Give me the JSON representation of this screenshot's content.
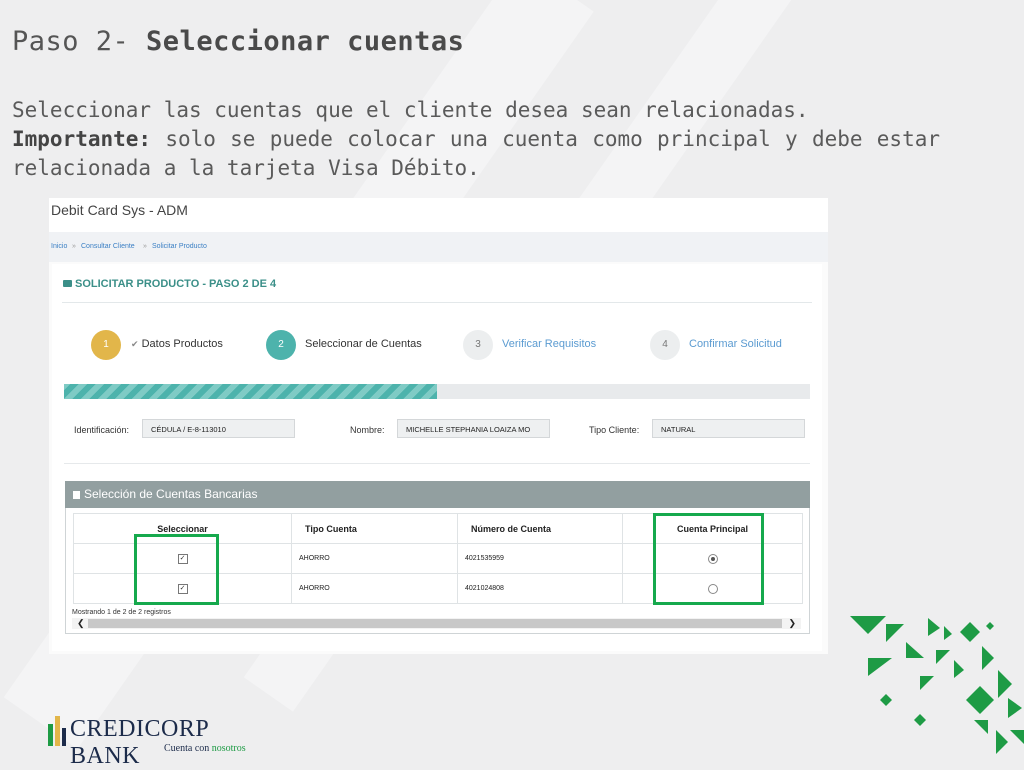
{
  "slide": {
    "title_prefix": "Paso 2- ",
    "title_bold": "Seleccionar cuentas",
    "body_line1": " Seleccionar las cuentas que el cliente desea sean relacionadas.",
    "important_label": "Importante:",
    "important_text": " solo se puede colocar una cuenta como principal y debe estar relacionada a la tarjeta Visa Débito."
  },
  "app": {
    "title": "Debit Card Sys - ADM",
    "breadcrumb": [
      "Inicio",
      "»",
      "Consultar Cliente",
      "»",
      "Solicitar Producto"
    ]
  },
  "panel": {
    "title": "SOLICITAR PRODUCTO - PASO 2 DE 4"
  },
  "steps": [
    {
      "number": "1",
      "label": "Datos Productos",
      "state": "done",
      "check": "✔"
    },
    {
      "number": "2",
      "label": "Seleccionar de Cuentas",
      "state": "active"
    },
    {
      "number": "3",
      "label": "Verificar Requisitos",
      "state": "pending"
    },
    {
      "number": "4",
      "label": "Confirmar Solicitud",
      "state": "pending"
    }
  ],
  "progress": {
    "percent": 50
  },
  "client": {
    "id_label": "Identificación:",
    "id_value": "CÉDULA / E-8-113010",
    "name_label": "Nombre:",
    "name_value": "MICHELLE STEPHANIA LOAIZA MO",
    "type_label": "Tipo Cliente:",
    "type_value": "NATURAL"
  },
  "accounts": {
    "header": "Selección de Cuentas Bancarias",
    "columns": [
      "Seleccionar",
      "Tipo Cuenta",
      "Número de Cuenta",
      "Cuenta Principal"
    ],
    "rows": [
      {
        "selected": true,
        "type": "AHORRO",
        "number": "4021535959",
        "principal": true
      },
      {
        "selected": true,
        "type": "AHORRO",
        "number": "4021024808",
        "principal": false
      }
    ],
    "records_text": "Mostrando 1 de 2 de 2 registros",
    "scroll_left": "❮",
    "scroll_right": "❯"
  },
  "logo": {
    "name": "CREDICORP BANK",
    "tagline_prefix": "Cuenta con ",
    "tagline_highlight": "nosotros"
  },
  "colors": {
    "accent_teal": "#4db3ac",
    "step_done": "#e2b64a",
    "highlight_green": "#16a94d",
    "brand_navy": "#1c2b4a",
    "brand_green": "#1e9b45"
  }
}
